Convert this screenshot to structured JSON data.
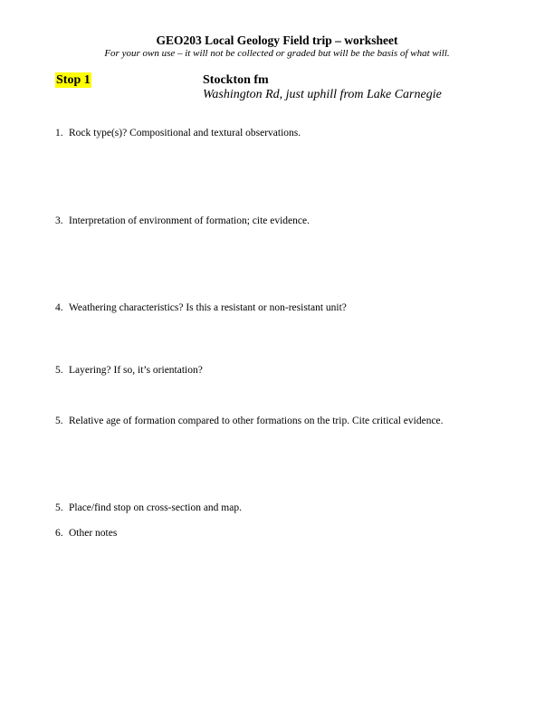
{
  "header": {
    "title": "GEO203 Local Geology Field trip – worksheet",
    "subtitle": "For your own use – it will not be collected or graded but will be the basis of what will."
  },
  "stop": {
    "label": "Stop 1",
    "name": "Stockton fm",
    "location": "Washington Rd, just uphill from Lake Carnegie"
  },
  "questions": [
    {
      "number": "1.",
      "text": "Rock type(s)?  Compositional and textural observations."
    },
    {
      "number": "3.",
      "text": "Interpretation of environment of formation; cite evidence."
    },
    {
      "number": "4.",
      "text": "Weathering characteristics?  Is this a resistant or non-resistant unit?"
    },
    {
      "number": "5.",
      "text": "Layering?  If so, it’s orientation?"
    },
    {
      "number": "5.",
      "text": "Relative age of formation compared to other formations on the trip.  Cite critical evidence."
    },
    {
      "number": "5.",
      "text": "Place/find stop on cross-section and map."
    },
    {
      "number": "6.",
      "text": "Other notes"
    }
  ],
  "colors": {
    "highlight": "#ffff00",
    "text": "#000000",
    "background": "#ffffff"
  }
}
